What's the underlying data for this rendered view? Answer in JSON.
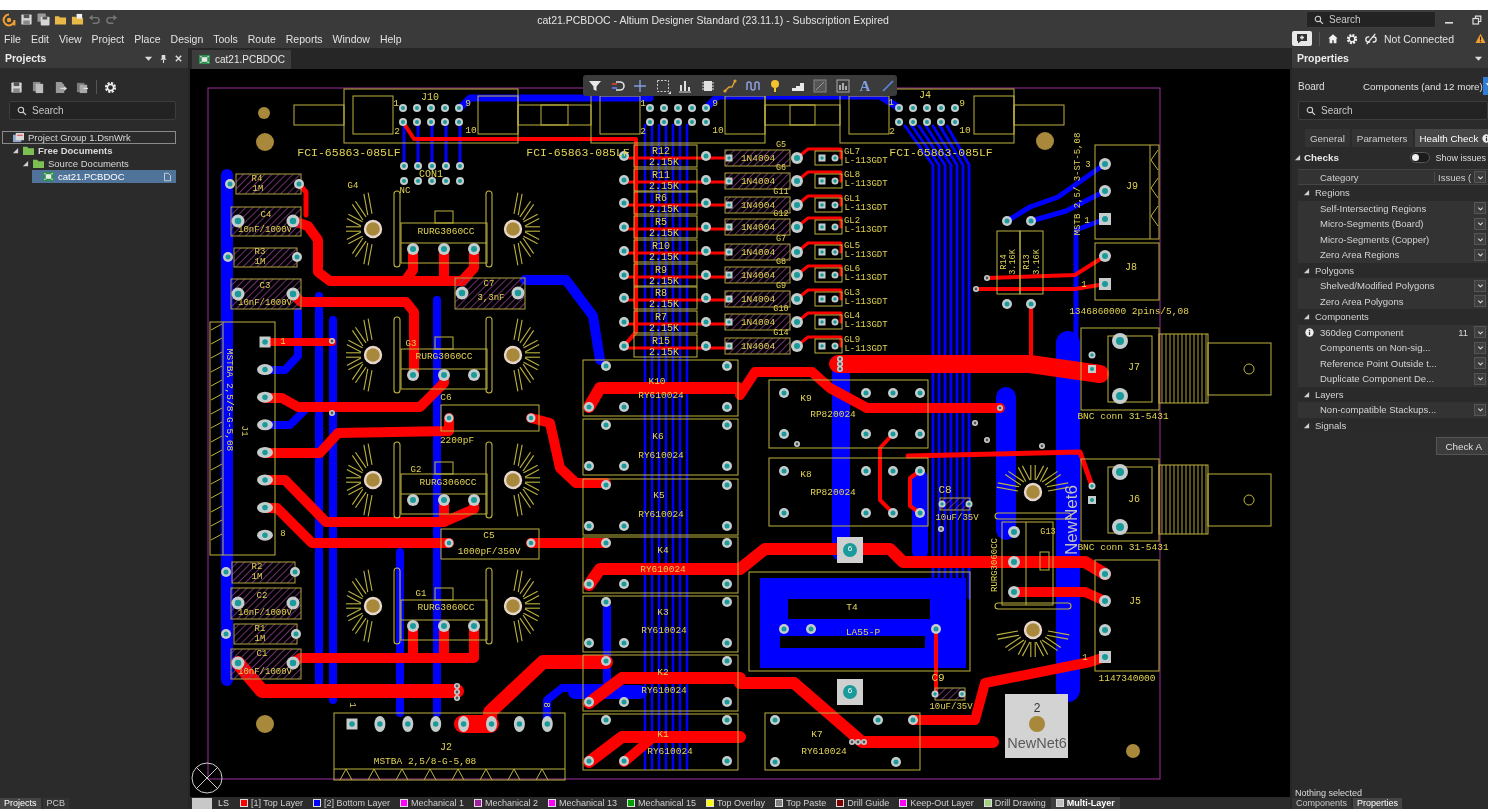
{
  "title_bar": {
    "title": "cat21.PCBDOC - Altium Designer Standard (23.11.1) - Subscription Expired",
    "search": {
      "placeholder": "Search"
    }
  },
  "menu": [
    "File",
    "Edit",
    "View",
    "Project",
    "Place",
    "Design",
    "Tools",
    "Route",
    "Reports",
    "Window",
    "Help"
  ],
  "account": {
    "status": "Not Connected"
  },
  "projects_panel": {
    "title": "Projects",
    "search": {
      "placeholder": "Search"
    },
    "tree": [
      {
        "label": "Project Group 1.DsnWrk",
        "kind": "workspace",
        "focused": true,
        "selected": false,
        "children": [
          {
            "label": "Free Documents",
            "kind": "project",
            "expanded": true,
            "focused": false,
            "selected": false,
            "children": [
              {
                "label": "Source Documents",
                "kind": "folder",
                "expanded": true,
                "focused": false,
                "selected": false,
                "children": [
                  {
                    "label": "cat21.PCBDOC",
                    "kind": "pcb-document",
                    "focused": false,
                    "selected": true
                  }
                ]
              }
            ]
          }
        ]
      }
    ],
    "tabs": [
      {
        "label": "Projects",
        "selected": true
      },
      {
        "label": "PCB",
        "selected": false
      }
    ]
  },
  "document_tabs": [
    {
      "label": "cat21.PCBDOC",
      "selected": true
    }
  ],
  "pcb_toolbar": {
    "text_tool": "A"
  },
  "board": {
    "components": [
      {
        "kind": "box-header",
        "designator": "J10",
        "comment": "FCI-65863-085LF",
        "pins": [
          "1",
          "9",
          "2",
          "10"
        ]
      },
      {
        "kind": "box-header",
        "comment": "FCI-65863-085LF",
        "pins": [
          "1",
          "9",
          "2",
          "10"
        ]
      },
      {
        "kind": "box-header",
        "designator": "J4",
        "comment": "FCI-65863-085LF",
        "pins": [
          "1",
          "9",
          "2",
          "10"
        ]
      },
      {
        "kind": "resistor",
        "designator": "R4",
        "comment": "1M"
      },
      {
        "kind": "pin-header",
        "designator": "CON1",
        "note": "NC"
      },
      {
        "kind": "capacitor",
        "designator": "C4",
        "comment": "10nF/1000V"
      },
      {
        "kind": "resistor",
        "designator": "R3",
        "comment": "1M"
      },
      {
        "kind": "capacitor",
        "designator": "C3",
        "comment": "10nF/1000V"
      },
      {
        "kind": "terminal-block",
        "designator": "J1",
        "comment": "MSTBA 2,5/8-G-5,08",
        "pins": [
          "1",
          "8"
        ]
      },
      {
        "kind": "resistor",
        "designator": "R2",
        "comment": "1M"
      },
      {
        "kind": "capacitor",
        "designator": "C2",
        "comment": "10nF/1000V"
      },
      {
        "kind": "resistor",
        "designator": "R1",
        "comment": "1M"
      },
      {
        "kind": "capacitor",
        "designator": "C1",
        "comment": "10nF/1000V"
      },
      {
        "kind": "rectifier",
        "designator": "G4",
        "comment": "RURG3060CC"
      },
      {
        "kind": "capacitor",
        "designator": "C7",
        "comment": "3,3nF"
      },
      {
        "kind": "rectifier",
        "designator": "G3",
        "comment": "RURG3060CC"
      },
      {
        "kind": "capacitor",
        "designator": "C6",
        "comment": "2200pF"
      },
      {
        "kind": "rectifier",
        "designator": "G2",
        "comment": "RURG3060CC"
      },
      {
        "kind": "capacitor",
        "designator": "C5",
        "comment": "1000pF/350V"
      },
      {
        "kind": "rectifier",
        "designator": "G1",
        "comment": "RURG3060CC"
      },
      {
        "kind": "terminal-block",
        "designator": "J2",
        "comment": "MSTBA 2,5/8-G-5,08",
        "pins": [
          "1",
          "8"
        ]
      },
      {
        "kind": "resistor",
        "designator": "R12",
        "comment": "2.15K"
      },
      {
        "kind": "resistor",
        "designator": "R11",
        "comment": "2.15K"
      },
      {
        "kind": "resistor",
        "designator": "R6",
        "comment": "2.15K"
      },
      {
        "kind": "resistor",
        "designator": "R5",
        "comment": "2.15K"
      },
      {
        "kind": "resistor",
        "designator": "R10",
        "comment": "2.15K"
      },
      {
        "kind": "resistor",
        "designator": "R9",
        "comment": "2.15K"
      },
      {
        "kind": "resistor",
        "designator": "R8",
        "comment": "2.15K"
      },
      {
        "kind": "resistor",
        "designator": "R7",
        "comment": "2.15K"
      },
      {
        "kind": "resistor",
        "designator": "R15",
        "comment": "2.15K"
      },
      {
        "kind": "diode",
        "designator": "G5",
        "comment": "1N4004"
      },
      {
        "kind": "diode",
        "designator": "G6",
        "comment": "1N4004"
      },
      {
        "kind": "diode",
        "designator": "G11",
        "comment": "1N4004"
      },
      {
        "kind": "diode",
        "designator": "G12",
        "comment": "1N4004"
      },
      {
        "kind": "diode",
        "designator": "G7",
        "comment": "1N4004"
      },
      {
        "kind": "diode",
        "designator": "G8",
        "comment": "1N4004"
      },
      {
        "kind": "diode",
        "designator": "G9",
        "comment": "1N4004"
      },
      {
        "kind": "diode",
        "designator": "G10",
        "comment": "1N4004"
      },
      {
        "kind": "diode",
        "designator": "G14",
        "comment": "1N4004"
      },
      {
        "kind": "led",
        "designator": "GL7",
        "comment": "L-113GDT"
      },
      {
        "kind": "led",
        "designator": "GL8",
        "comment": "L-113GDT"
      },
      {
        "kind": "led",
        "designator": "GL1",
        "comment": "L-113GDT"
      },
      {
        "kind": "led",
        "designator": "GL2",
        "comment": "L-113GDT"
      },
      {
        "kind": "led",
        "designator": "GL5",
        "comment": "L-113GDT"
      },
      {
        "kind": "led",
        "designator": "GL6",
        "comment": "L-113GDT"
      },
      {
        "kind": "led",
        "designator": "GL3",
        "comment": "L-113GDT"
      },
      {
        "kind": "led",
        "designator": "GL4",
        "comment": "L-113GDT"
      },
      {
        "kind": "led",
        "designator": "GL9",
        "comment": "L-113GDT"
      },
      {
        "kind": "relay",
        "designator": "K10",
        "comment": "RY610024"
      },
      {
        "kind": "relay",
        "designator": "K6",
        "comment": "RY610024"
      },
      {
        "kind": "relay",
        "designator": "K5",
        "comment": "RY610024"
      },
      {
        "kind": "relay",
        "designator": "K4",
        "comment": "RY610024"
      },
      {
        "kind": "relay",
        "designator": "K3",
        "comment": "RY610024"
      },
      {
        "kind": "relay",
        "designator": "K2",
        "comment": "RY610024"
      },
      {
        "kind": "relay",
        "designator": "K1",
        "comment": "RY610024"
      },
      {
        "kind": "relay",
        "designator": "K9",
        "comment": "RP820024"
      },
      {
        "kind": "relay",
        "designator": "K8",
        "comment": "RP820024"
      },
      {
        "kind": "transducer",
        "designator": "T4",
        "comment": "LA55-P"
      },
      {
        "kind": "relay",
        "designator": "K7",
        "comment": "RY610024"
      },
      {
        "kind": "electrolytic-capacitor",
        "designator": "C8",
        "comment": "10uF/35V"
      },
      {
        "kind": "electrolytic-capacitor",
        "designator": "C9",
        "comment": "10uF/35V"
      },
      {
        "kind": "resistor",
        "designator": "R14",
        "comment": "3.16K"
      },
      {
        "kind": "resistor",
        "designator": "R13",
        "comment": "3.16K"
      },
      {
        "kind": "rectifier",
        "designator": "G13",
        "comment": "RURG3060CC"
      },
      {
        "kind": "terminal-block",
        "designator": "J9",
        "comment": "MSTB 2,5/ 3-ST-5,08",
        "pins": [
          "3",
          "1"
        ]
      },
      {
        "kind": "terminal-block",
        "designator": "J8",
        "comment": "1346860000 2pins/5,08",
        "pins": [
          "1"
        ]
      },
      {
        "kind": "bnc-connector",
        "designator": "J7",
        "comment": "BNC conn 31-5431"
      },
      {
        "kind": "bnc-connector",
        "designator": "J6",
        "comment": "BNC conn 31-5431"
      },
      {
        "kind": "terminal-block",
        "designator": "J5",
        "comment": "1147340000",
        "pins": [
          "1"
        ]
      }
    ],
    "net_labels": [
      {
        "kind": "vertical",
        "text": "NewNet6"
      },
      {
        "kind": "pad-box",
        "pad": "2",
        "text": "NewNet6"
      },
      {
        "kind": "chip",
        "text": "6"
      },
      {
        "kind": "chip",
        "text": "6"
      }
    ]
  },
  "layer_bar": {
    "layer_set": "LS",
    "layers": [
      {
        "label": "[1] Top Layer",
        "color": "#ff0000",
        "selected": false
      },
      {
        "label": "[2] Bottom Layer",
        "color": "#0000ff",
        "selected": false
      },
      {
        "label": "Mechanical 1",
        "color": "#ff00ff",
        "selected": false
      },
      {
        "label": "Mechanical 2",
        "color": "#a020a0",
        "selected": false
      },
      {
        "label": "Mechanical 13",
        "color": "#ff00ff",
        "selected": false
      },
      {
        "label": "Mechanical 15",
        "color": "#00a000",
        "selected": false
      },
      {
        "label": "Top Overlay",
        "color": "#ffff00",
        "selected": false
      },
      {
        "label": "Top Paste",
        "color": "#808080",
        "selected": false
      },
      {
        "label": "Drill Guide",
        "color": "#800000",
        "selected": false
      },
      {
        "label": "Keep-Out Layer",
        "color": "#ff00ff",
        "selected": false
      },
      {
        "label": "Drill Drawing",
        "color": "#a0d080",
        "selected": false
      },
      {
        "label": "Multi-Layer",
        "color": "#c0c0c0",
        "selected": true
      }
    ]
  },
  "properties_panel": {
    "title": "Properties",
    "filter": {
      "label": "Board",
      "value": "Components (and 12 more)"
    },
    "search": {
      "placeholder": "Search"
    },
    "tabs": [
      {
        "label": "General",
        "selected": false
      },
      {
        "label": "Parameters",
        "selected": false
      },
      {
        "label": "Health Check",
        "selected": true
      }
    ],
    "checks": {
      "label": "Checks",
      "expanded": true,
      "toggle": {
        "label": "Show issues",
        "on": false
      },
      "columns": [
        "Category",
        "Issues ("
      ],
      "groups": [
        {
          "label": "Regions",
          "expanded": true,
          "children": [
            {
              "label": "Self-Intersecting Regions"
            },
            {
              "label": "Micro-Segments (Board)"
            },
            {
              "label": "Micro-Segments (Copper)"
            },
            {
              "label": "Zero Area Regions"
            }
          ]
        },
        {
          "label": "Polygons",
          "expanded": true,
          "children": [
            {
              "label": "Shelved/Modified Polygons"
            },
            {
              "label": "Zero Area Polygons"
            }
          ]
        },
        {
          "label": "Components",
          "expanded": true,
          "children": [
            {
              "label": "360deg Component",
              "issues": "11"
            },
            {
              "label": "Components on Non-sig..."
            },
            {
              "label": "Reference Point Outside t..."
            },
            {
              "label": "Duplicate Component De..."
            }
          ]
        },
        {
          "label": "Layers",
          "expanded": true,
          "children": [
            {
              "label": "Non-compatible Stackups..."
            }
          ]
        },
        {
          "label": "Signals",
          "expanded": true
        }
      ],
      "button": "Check A"
    },
    "status": "Nothing selected",
    "tabs_bottom": [
      {
        "label": "Components",
        "selected": false
      },
      {
        "label": "Properties",
        "selected": true
      }
    ]
  }
}
